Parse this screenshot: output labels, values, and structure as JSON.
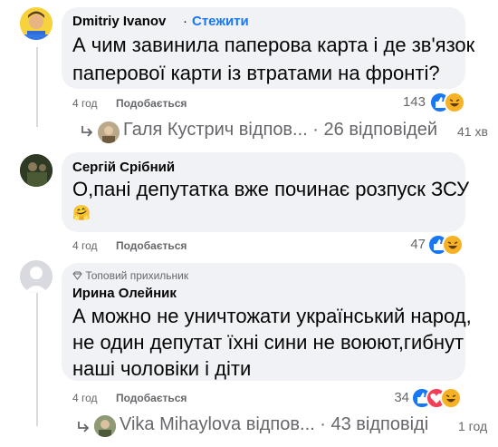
{
  "comments": [
    {
      "author": "Dmitriy Ivanov",
      "follow_sep": "·",
      "follow_label": "Стежити",
      "text_lines": [
        "А чим завинила паперова карта і де зв'язок",
        "паперової карти із втратами на фронті?"
      ],
      "time": "4 год",
      "like_label": "Подобається",
      "reactions_count": "143"
    },
    {
      "author": "Сергій Срібний",
      "text_lines": [
        "О,пані депутатка вже починає розпуск ЗСУ"
      ],
      "emoji": "🤗",
      "time": "4 год",
      "like_label": "Подобається",
      "reactions_count": "47"
    },
    {
      "badge": "Топовий прихильник",
      "author": "Ирина Олейник",
      "text_lines": [
        "А можно не уничтожати український народ,",
        "не один депутат їхні сини не воюют,гибнут",
        "наші чоловіки і діти"
      ],
      "time": "4 год",
      "like_label": "Подобається",
      "reactions_count": "34"
    }
  ],
  "replies": [
    {
      "name": "Галя Кустрич відпов...",
      "sep": "·",
      "count": "26 відповідей",
      "time": "41 хв"
    },
    {
      "name": "Vika Mihaylova відпов...",
      "sep": "·",
      "count": "43 відповіді",
      "time": "1 год"
    }
  ],
  "colors": {
    "like": "#1877f2",
    "follow": "#1877f2",
    "haha": "#f7b125",
    "love": "#f33e58",
    "bubble": "#f0f2f5"
  }
}
